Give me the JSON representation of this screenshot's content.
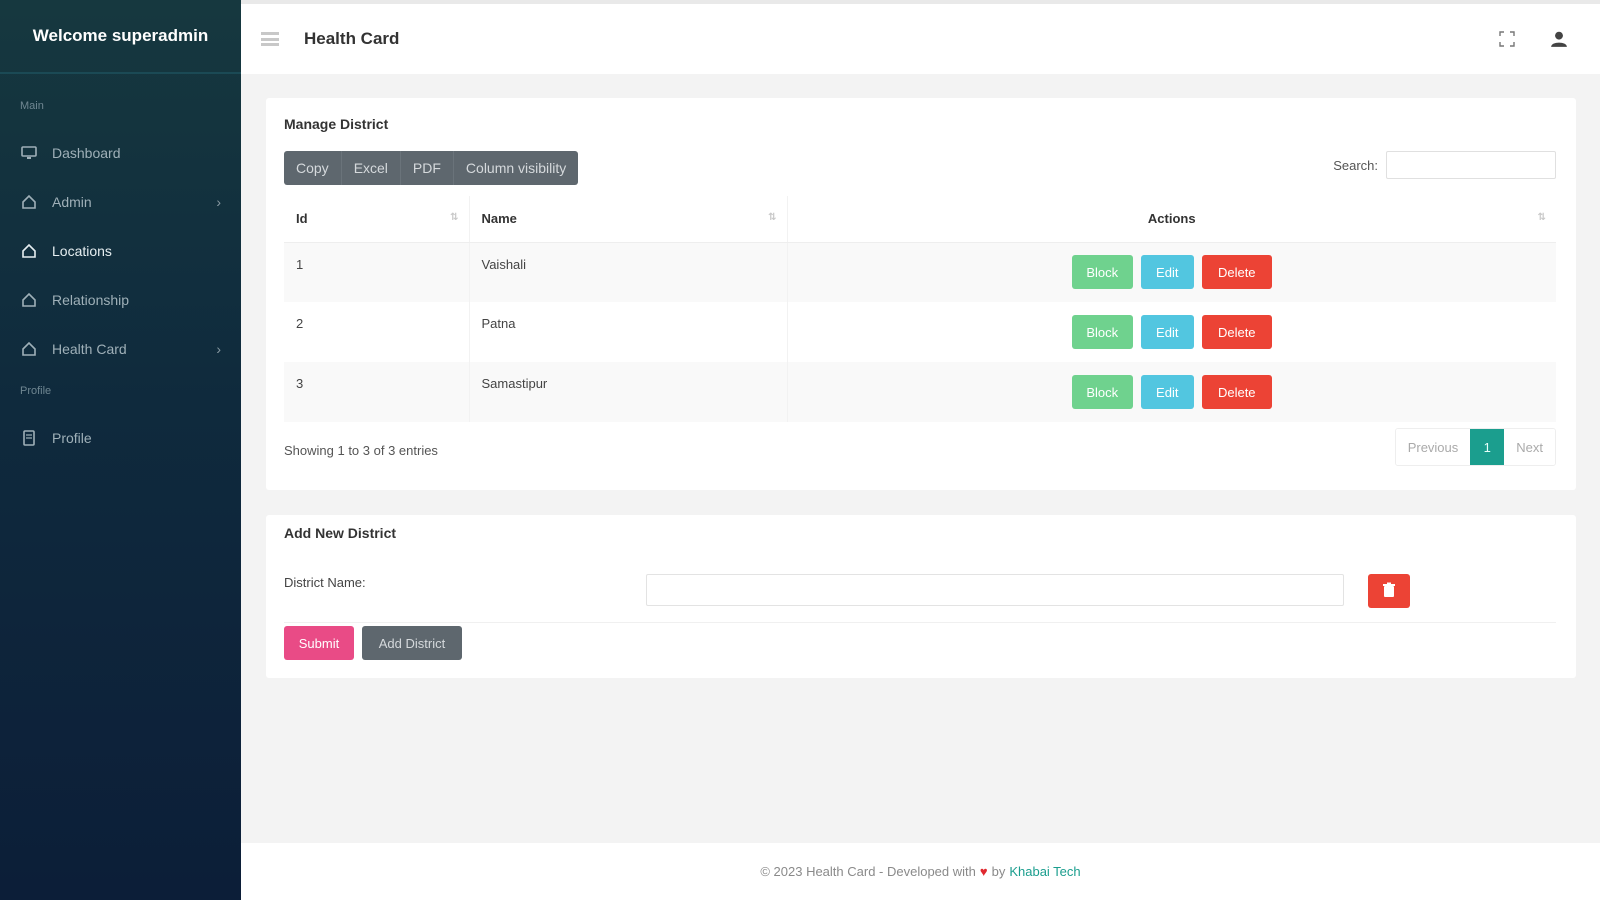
{
  "sidebar": {
    "brand": "Welcome superadmin",
    "section_main": "Main",
    "section_profile": "Profile",
    "items": [
      {
        "label": "Dashboard",
        "icon": "monitor-icon"
      },
      {
        "label": "Admin",
        "icon": "home-icon",
        "has_submenu": true
      },
      {
        "label": "Locations",
        "icon": "home-icon",
        "active": true
      },
      {
        "label": "Relationship",
        "icon": "home-icon"
      },
      {
        "label": "Health Card",
        "icon": "home-icon",
        "has_submenu": true
      }
    ],
    "profile_item": {
      "label": "Profile",
      "icon": "document-icon"
    }
  },
  "topbar": {
    "title": "Health Card",
    "icons": [
      "menu-icon",
      "fullscreen-icon",
      "user-icon"
    ]
  },
  "manage": {
    "title": "Manage District",
    "buttons": [
      "Copy",
      "Excel",
      "PDF",
      "Column visibility"
    ],
    "search_label": "Search:",
    "search_value": "",
    "columns": [
      "Id",
      "Name",
      "Actions"
    ],
    "rows": [
      {
        "id": "1",
        "name": "Vaishali"
      },
      {
        "id": "2",
        "name": "Patna"
      },
      {
        "id": "3",
        "name": "Samastipur"
      }
    ],
    "action_labels": {
      "block": "Block",
      "edit": "Edit",
      "delete": "Delete"
    },
    "info": "Showing 1 to 3 of 3 entries",
    "pager": {
      "previous": "Previous",
      "current": "1",
      "next": "Next"
    }
  },
  "add": {
    "title": "Add New District",
    "field_label": "District Name:",
    "field_value": "",
    "submit": "Submit",
    "add_district": "Add District"
  },
  "footer": {
    "text_before": "© 2023 Health Card - Developed with",
    "heart": "♥",
    "text_by": "by",
    "company": "Khabai Tech"
  },
  "colors": {
    "accent": "#1b9e8e",
    "block": "#6fd28e",
    "edit": "#52c6e0",
    "delete": "#ec4335",
    "submit": "#e94b86"
  }
}
